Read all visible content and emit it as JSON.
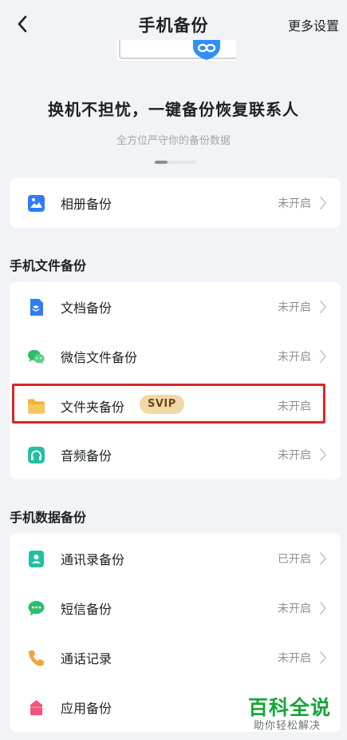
{
  "header": {
    "title": "手机备份",
    "more_settings": "更多设置"
  },
  "banner": {
    "headline": "换机不担忧，一键备份恢复联系人",
    "subline": "全方位严守你的备份数据"
  },
  "album": {
    "label": "相册备份",
    "status": "未开启",
    "icon": "image-icon",
    "color": "#2f7cf6"
  },
  "files_section": {
    "title": "手机文件备份",
    "items": [
      {
        "label": "文档备份",
        "status": "未开启",
        "icon": "document-icon",
        "color": "#2f7cf6"
      },
      {
        "label": "微信文件备份",
        "status": "未开启",
        "icon": "wechat-icon",
        "color": "#2ebd6b"
      },
      {
        "label": "文件夹备份",
        "status": "未开启",
        "icon": "folder-icon",
        "color": "#f4b23e",
        "badge": "SVIP"
      },
      {
        "label": "音频备份",
        "status": "未开启",
        "icon": "headphones-icon",
        "color": "#22c0a3"
      }
    ]
  },
  "data_section": {
    "title": "手机数据备份",
    "items": [
      {
        "label": "通讯录备份",
        "status": "已开启",
        "icon": "contacts-icon",
        "color": "#22c0a3"
      },
      {
        "label": "短信备份",
        "status": "未开启",
        "icon": "sms-icon",
        "color": "#2ebd6b"
      },
      {
        "label": "通话记录",
        "status": "未开启",
        "icon": "phone-icon",
        "color": "#f4a33b"
      },
      {
        "label": "应用备份",
        "status": "未开启",
        "icon": "app-icon",
        "color": "#f0567b"
      }
    ]
  },
  "watermark": {
    "main": "百科全说",
    "sub": "助你轻松解决"
  }
}
